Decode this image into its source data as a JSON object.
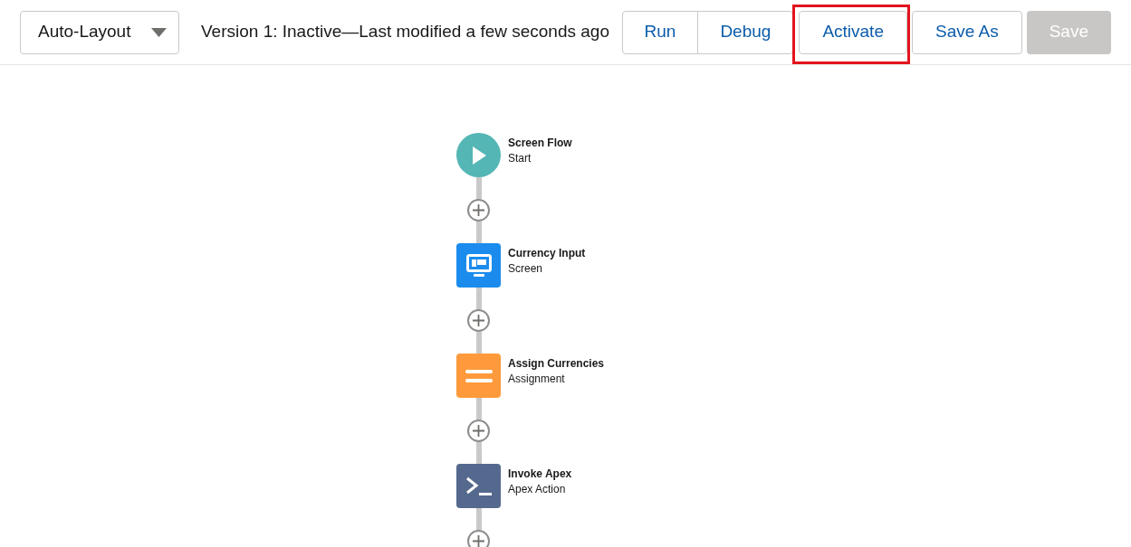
{
  "layout_menu": {
    "value": "Auto-Layout"
  },
  "status": "Version 1: Inactive—Last modified a few seconds ago",
  "button_group": [
    {
      "label": "Run"
    },
    {
      "label": "Debug"
    }
  ],
  "buttons": [
    {
      "label": "Activate",
      "disabled": false,
      "highlighted": true
    },
    {
      "label": "Save As",
      "disabled": false,
      "highlighted": false
    },
    {
      "label": "Save",
      "disabled": true,
      "highlighted": false
    }
  ],
  "nodes": [
    {
      "kind": "start",
      "title": "Screen Flow",
      "subtitle": "Start"
    },
    {
      "kind": "screen",
      "title": "Currency Input",
      "subtitle": "Screen"
    },
    {
      "kind": "assignment",
      "title": "Assign Currencies",
      "subtitle": "Assignment"
    },
    {
      "kind": "action",
      "title": "Invoke Apex",
      "subtitle": "Apex Action"
    }
  ]
}
